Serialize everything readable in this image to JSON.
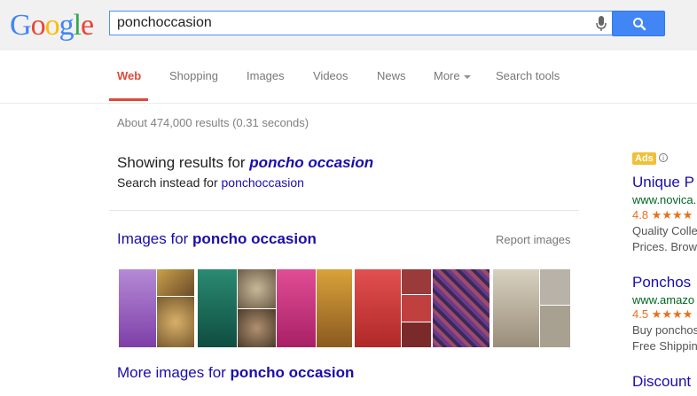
{
  "search": {
    "query": "ponchoccasion",
    "logo": [
      "G",
      "o",
      "o",
      "g",
      "l",
      "e"
    ],
    "logo_colors": [
      "#4285f4",
      "#ea4335",
      "#fbbc05",
      "#4285f4",
      "#34a853",
      "#ea4335"
    ]
  },
  "tabs": [
    {
      "label": "Web",
      "active": true
    },
    {
      "label": "Shopping"
    },
    {
      "label": "Images"
    },
    {
      "label": "Videos"
    },
    {
      "label": "News"
    },
    {
      "label": "More"
    },
    {
      "label": "Search tools"
    }
  ],
  "stats": "About 474,000 results (0.31 seconds)",
  "correction": {
    "showing_prefix": "Showing results for ",
    "showing_term": "poncho occasion",
    "instead_prefix": "Search instead for ",
    "instead_term": "ponchoccasion"
  },
  "images": {
    "title_prefix": "Images for ",
    "title_term": "poncho occasion",
    "report": "Report images",
    "more_prefix": "More images for ",
    "more_term": "poncho occasion",
    "thumb_colors": [
      "#9b59b6",
      "#c9a14a",
      "#1f6e5e",
      "#c0307a",
      "#d94a4a",
      "#8b3a3a",
      "#7a5c9c",
      "#d8d0c0",
      "#b9b2a8"
    ]
  },
  "ads": {
    "badge": "Ads",
    "items": [
      {
        "title": "Unique P",
        "url": "www.novica.",
        "rating": "4.8 ★★★★",
        "desc": [
          "Quality Colle",
          "Prices. Brow"
        ]
      },
      {
        "title": "Ponchos",
        "url": "www.amazo",
        "rating": "4.5 ★★★★",
        "desc": [
          "Buy ponchos",
          "Free Shippin"
        ]
      },
      {
        "title": "Discount",
        "url": "",
        "rating": "",
        "desc": []
      }
    ]
  },
  "colors": {
    "link": "#1a0dab",
    "url_green": "#006621",
    "active_tab": "#dd4b39",
    "search_blue": "#4285f4"
  }
}
